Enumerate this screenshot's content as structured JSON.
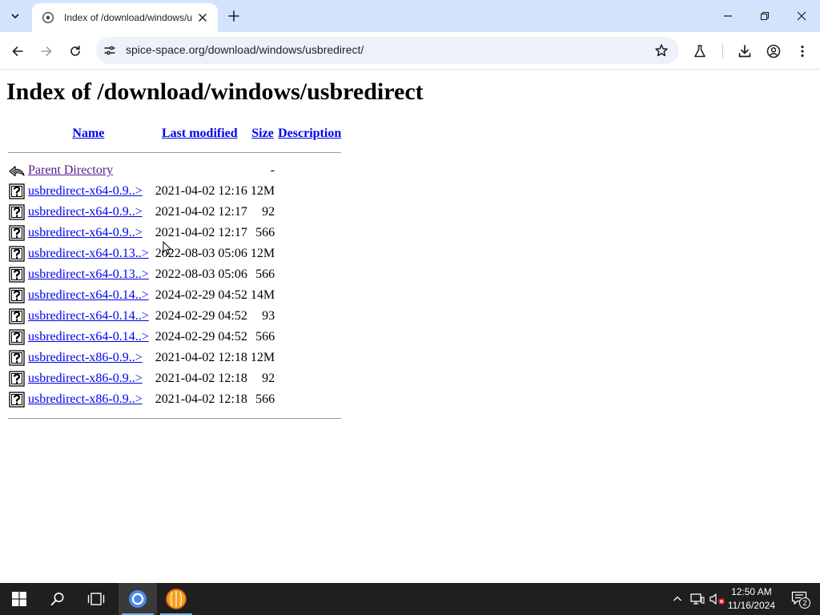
{
  "browser": {
    "tab": {
      "title": "Index of /download/windows/u"
    },
    "omnibox": {
      "url": "spice-space.org/download/windows/usbredirect/"
    }
  },
  "page": {
    "heading": "Index of /download/windows/usbredirect",
    "columns": {
      "name": "Name",
      "last_modified": "Last modified",
      "size": "Size",
      "description": "Description"
    },
    "parent": {
      "name": "Parent Directory",
      "size": "-"
    },
    "rows": [
      {
        "name": "usbredirect-x64-0.9..>",
        "modified": "2021-04-02 12:16",
        "size": "12M"
      },
      {
        "name": "usbredirect-x64-0.9..>",
        "modified": "2021-04-02 12:17",
        "size": "92"
      },
      {
        "name": "usbredirect-x64-0.9..>",
        "modified": "2021-04-02 12:17",
        "size": "566"
      },
      {
        "name": "usbredirect-x64-0.13..>",
        "modified": "2022-08-03 05:06",
        "size": "12M"
      },
      {
        "name": "usbredirect-x64-0.13..>",
        "modified": "2022-08-03 05:06",
        "size": "566"
      },
      {
        "name": "usbredirect-x64-0.14..>",
        "modified": "2024-02-29 04:52",
        "size": "14M"
      },
      {
        "name": "usbredirect-x64-0.14..>",
        "modified": "2024-02-29 04:52",
        "size": "93"
      },
      {
        "name": "usbredirect-x64-0.14..>",
        "modified": "2024-02-29 04:52",
        "size": "566"
      },
      {
        "name": "usbredirect-x86-0.9..>",
        "modified": "2021-04-02 12:18",
        "size": "12M"
      },
      {
        "name": "usbredirect-x86-0.9..>",
        "modified": "2021-04-02 12:18",
        "size": "92"
      },
      {
        "name": "usbredirect-x86-0.9..>",
        "modified": "2021-04-02 12:18",
        "size": "566"
      }
    ]
  },
  "taskbar": {
    "time": "12:50 AM",
    "date": "11/16/2024",
    "notification_count": "2"
  },
  "icons": {
    "file": "unknown-file-icon",
    "parent": "back-arrow-icon"
  }
}
